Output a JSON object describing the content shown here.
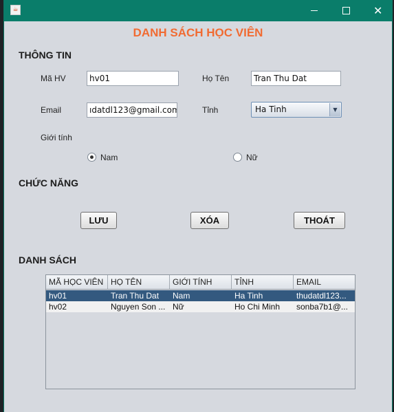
{
  "window": {
    "app_icon": "java-cup-icon",
    "controls": {
      "minimize": "minimize-icon",
      "maximize": "maximize-icon",
      "close": "close-icon"
    }
  },
  "heading": "DANH SÁCH HỌC VIÊN",
  "sections": {
    "info": "THÔNG TIN",
    "functions": "CHỨC NĂNG",
    "list": "DANH SÁCH"
  },
  "form": {
    "ma_hv_label": "Mã HV",
    "ma_hv_value": "hv01",
    "ho_ten_label": "Họ Tên",
    "ho_ten_value": "Tran Thu Dat",
    "email_label": "Email",
    "email_value": "ıdatdl123@gmail.com",
    "tinh_label": "Tỉnh",
    "tinh_selected": "Ha Tinh",
    "gioi_tinh_label": "Giới tính",
    "gender_options": [
      {
        "label": "Nam",
        "selected": true
      },
      {
        "label": "Nữ",
        "selected": false
      }
    ]
  },
  "buttons": {
    "save": "LƯU",
    "delete": "XÓA",
    "exit": "THOÁT"
  },
  "table": {
    "columns": [
      "MÃ HỌC VIÊN",
      "HỌ TÊN",
      "GIỚI TÍNH",
      "TỈNH",
      "EMAIL"
    ],
    "rows": [
      [
        "hv01",
        "Tran Thu Dat",
        "Nam",
        "Ha Tinh",
        "thudatdl123..."
      ],
      [
        "hv02",
        "Nguyen Son ...",
        "Nữ",
        "Ho Chi Minh",
        "sonba7b1@..."
      ]
    ],
    "selected_row": 0
  },
  "colors": {
    "titlebar": "#0a7d6a",
    "heading": "#f16b32",
    "selection": "#33597f",
    "panel": "#d6d9df"
  }
}
